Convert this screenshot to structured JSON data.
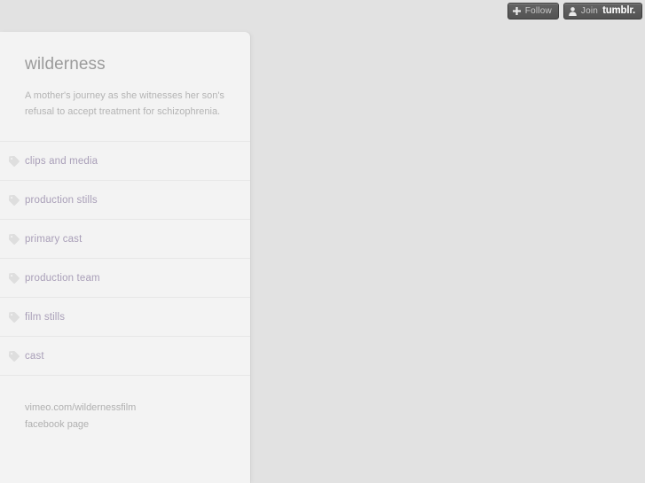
{
  "tumblr_bar": {
    "follow_button": {
      "label": "Follow",
      "icon": "plus-icon"
    },
    "join_button": {
      "label": "Join",
      "brand": "tumblr.",
      "icon": "person-icon"
    },
    "background_color": "#5a5a5a"
  },
  "sidebar": {
    "title": "wilderness",
    "description": "A mother's journey as she witnesses her son's refusal to accept treatment for schizophrenia.",
    "background_color": "#f3f3f3",
    "link_color": "#a99fb8",
    "items": [
      {
        "label": "clips and media",
        "icon": "tag-icon"
      },
      {
        "label": "production stills",
        "icon": "tag-icon"
      },
      {
        "label": "primary cast",
        "icon": "tag-icon"
      },
      {
        "label": "production team",
        "icon": "tag-icon"
      },
      {
        "label": "film stills",
        "icon": "tag-icon"
      },
      {
        "label": "cast",
        "icon": "tag-icon"
      }
    ],
    "footer_links": [
      {
        "label": "vimeo.com/wildernessfilm"
      },
      {
        "label": "facebook page"
      }
    ]
  },
  "page": {
    "background_color": "#e2e2e2"
  }
}
